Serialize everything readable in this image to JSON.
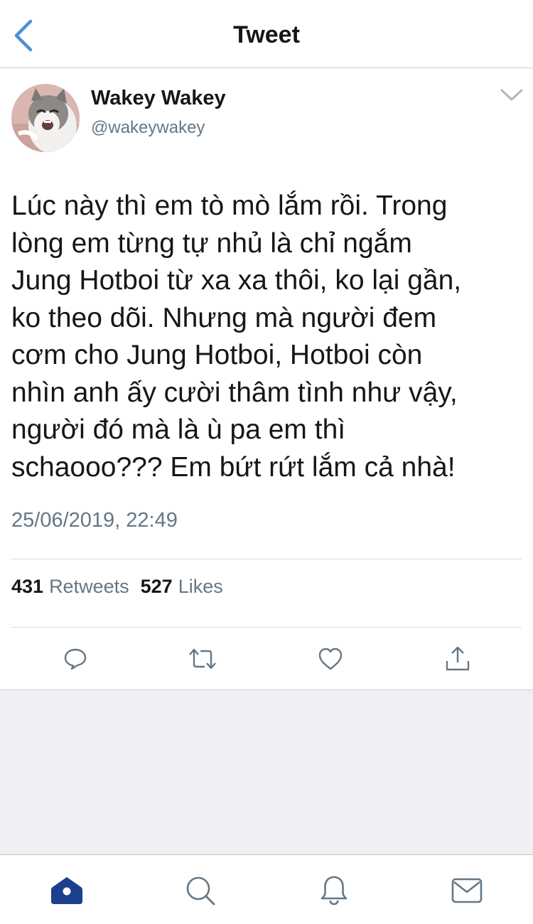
{
  "header": {
    "title": "Tweet",
    "back_icon": "chevron-left-icon"
  },
  "tweet": {
    "author": {
      "display_name": "Wakey Wakey",
      "handle": "@wakeywakey"
    },
    "text": "Lúc này thì em tò mò lắm rồi. Trong\nlòng em từng tự nhủ là chỉ ngắm\nJung Hotboi từ xa xa thôi, ko lại gần,\nko theo dõi. Nhưng mà người đem\ncơm cho Jung Hotboi, Hotboi còn\nnhìn anh ấy cười thâm tình như vậy,\nngười đó mà là ù pa em thì\nschaooo??? Em bứt rứt lắm cả nhà!",
    "timestamp": "25/06/2019, 22:49",
    "stats": {
      "retweets_count": "431",
      "retweets_label": "Retweets",
      "likes_count": "527",
      "likes_label": "Likes"
    },
    "actions": [
      "reply-icon",
      "retweet-icon",
      "like-icon",
      "share-icon"
    ]
  },
  "tabbar": {
    "items": [
      "home-icon",
      "search-icon",
      "notifications-icon",
      "messages-icon"
    ],
    "active": "home-icon"
  },
  "colors": {
    "accent": "#4a90d9",
    "tab_active": "#1d3f8c",
    "text_primary": "#14171a",
    "text_secondary": "#657786",
    "background_gray": "#efeff4"
  }
}
